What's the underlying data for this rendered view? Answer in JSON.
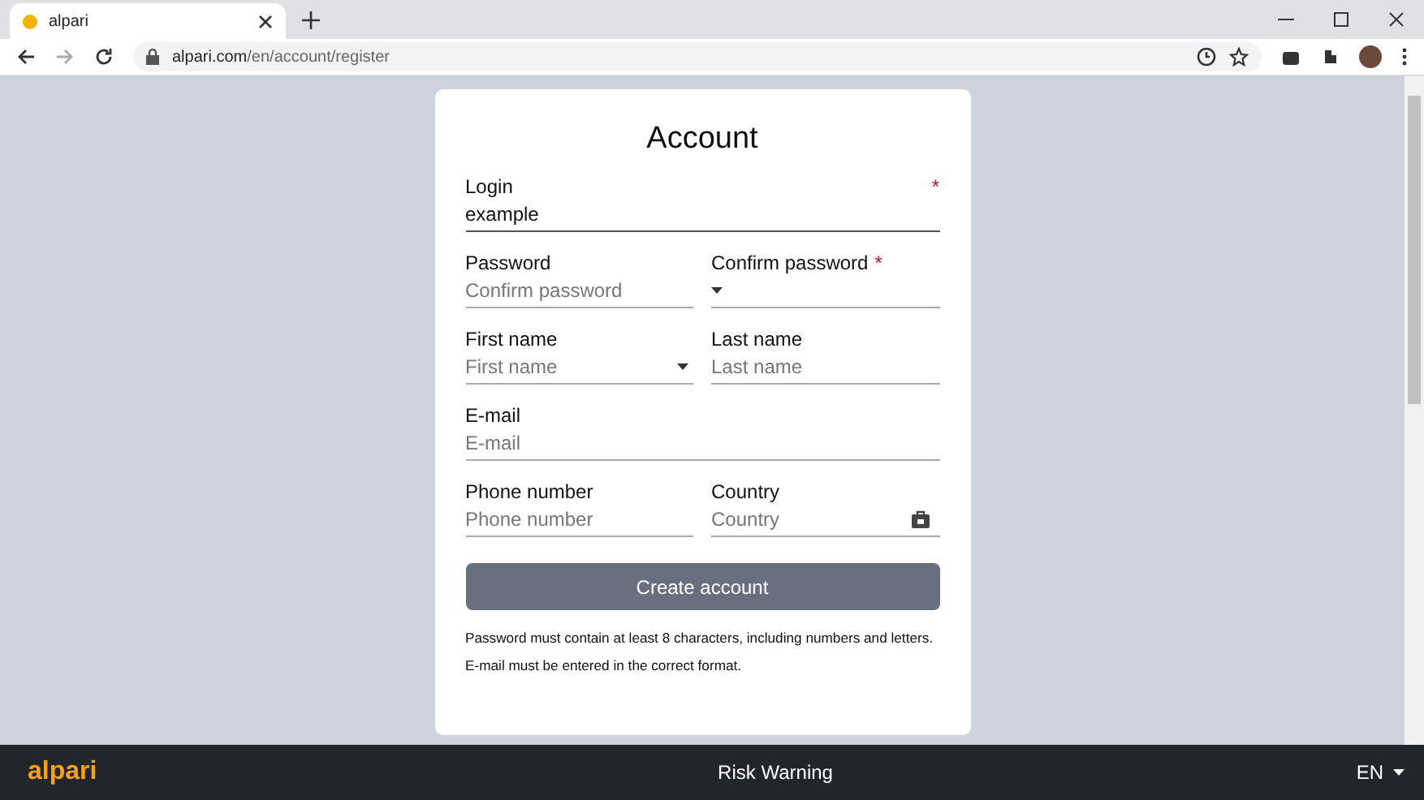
{
  "browser": {
    "tab": {
      "title": "alpari",
      "selected": true
    },
    "url": {
      "host": "alpari.com",
      "path": "/en/account/register"
    }
  },
  "form": {
    "title": "Account",
    "rows": [
      [
        {
          "label": "Login",
          "required_mark": "*",
          "value": "example"
        }
      ],
      [
        {
          "label": "Password",
          "placeholder": "Confirm password"
        },
        {
          "label": "Confirm password",
          "required_mark": "*",
          "dropdown": true
        }
      ],
      [
        {
          "label": "First name",
          "placeholder": "First name",
          "dropdown": true
        },
        {
          "label": "Last name",
          "placeholder": "Last name"
        }
      ],
      [
        {
          "label": "E-mail",
          "placeholder": "E-mail"
        }
      ],
      [
        {
          "label": "Phone number",
          "placeholder": "Phone number"
        },
        {
          "label": "Country",
          "placeholder": "Country",
          "icon": true
        }
      ]
    ],
    "submit": "Create account",
    "notes": [
      "Password must contain at least 8 characters, including numbers and letters.",
      "E-mail must be entered in the correct format."
    ]
  },
  "footer": {
    "logo": "alpari",
    "link": "Risk Warning",
    "language": "EN"
  }
}
